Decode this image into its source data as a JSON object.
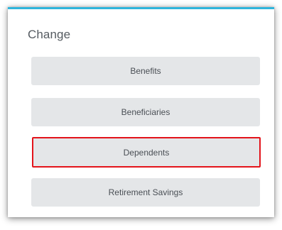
{
  "panel": {
    "title": "Change",
    "accent_color": "#2fb5dc",
    "highlight_color": "#e3141b",
    "options": [
      {
        "label": "Benefits",
        "highlighted": false
      },
      {
        "label": "Beneficiaries",
        "highlighted": false
      },
      {
        "label": "Dependents",
        "highlighted": true
      },
      {
        "label": "Retirement Savings",
        "highlighted": false
      }
    ]
  }
}
